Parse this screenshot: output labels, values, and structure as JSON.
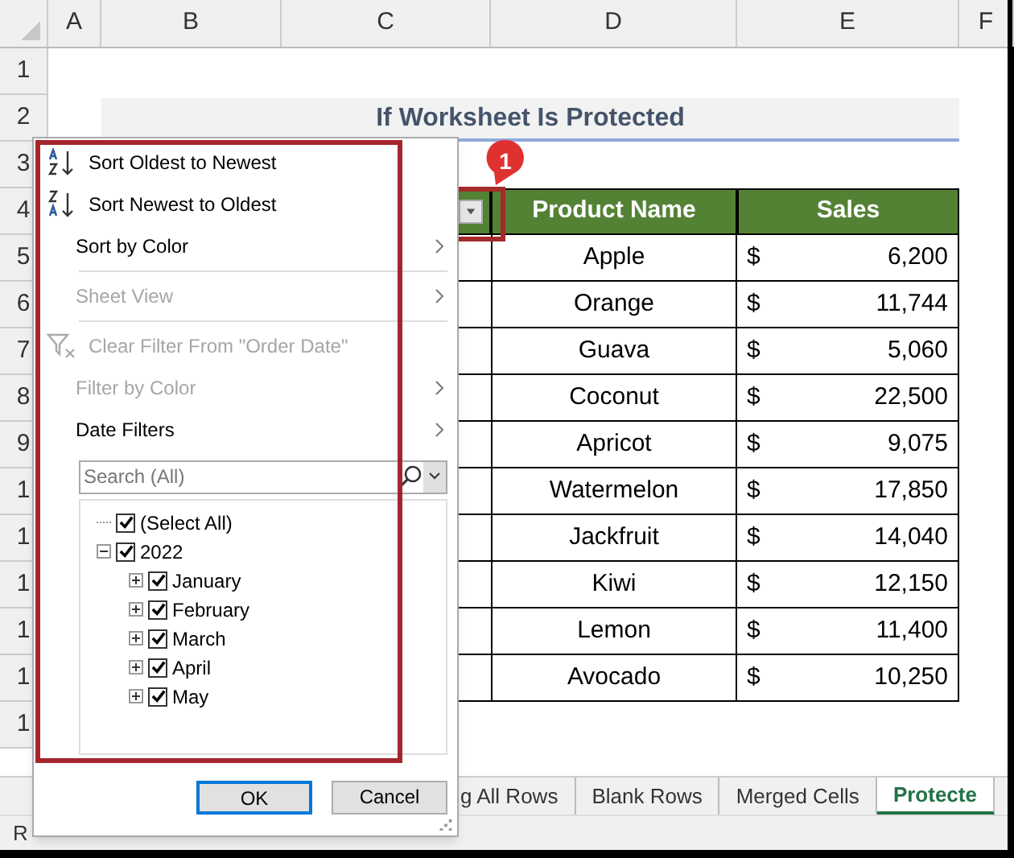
{
  "columns": [
    "A",
    "B",
    "C",
    "D",
    "E",
    "F"
  ],
  "row_numbers": [
    "1",
    "2",
    "3",
    "4",
    "5",
    "6",
    "7",
    "8",
    "9",
    "1",
    "1",
    "1",
    "1",
    "1",
    "1"
  ],
  "title": "If Worksheet Is Protected",
  "table": {
    "columns": [
      "Product Name",
      "Sales"
    ],
    "rows": [
      {
        "product": "Apple",
        "currency": "$",
        "sales": "6,200"
      },
      {
        "product": "Orange",
        "currency": "$",
        "sales": "11,744"
      },
      {
        "product": "Guava",
        "currency": "$",
        "sales": "5,060"
      },
      {
        "product": "Coconut",
        "currency": "$",
        "sales": "22,500"
      },
      {
        "product": "Apricot",
        "currency": "$",
        "sales": "9,075"
      },
      {
        "product": "Watermelon",
        "currency": "$",
        "sales": "17,850"
      },
      {
        "product": "Jackfruit",
        "currency": "$",
        "sales": "14,040"
      },
      {
        "product": "Kiwi",
        "currency": "$",
        "sales": "12,150"
      },
      {
        "product": "Lemon",
        "currency": "$",
        "sales": "11,400"
      },
      {
        "product": "Avocado",
        "currency": "$",
        "sales": "10,250"
      }
    ]
  },
  "callout": {
    "label": "1"
  },
  "filter_menu": {
    "items": [
      {
        "kind": "sort_asc",
        "label": "Sort Oldest to Newest",
        "disabled": false,
        "submenu": false
      },
      {
        "kind": "sort_desc",
        "label": "Sort Newest to Oldest",
        "disabled": false,
        "submenu": false
      },
      {
        "kind": "plain",
        "label": "Sort by Color",
        "disabled": false,
        "submenu": true
      },
      {
        "kind": "separator"
      },
      {
        "kind": "plain",
        "label": "Sheet View",
        "disabled": true,
        "submenu": true
      },
      {
        "kind": "separator"
      },
      {
        "kind": "clear_filter",
        "label": "Clear Filter From \"Order Date\"",
        "disabled": true,
        "submenu": false
      },
      {
        "kind": "plain",
        "label": "Filter by Color",
        "disabled": true,
        "submenu": true
      },
      {
        "kind": "plain",
        "label": "Date Filters",
        "disabled": false,
        "submenu": true
      }
    ],
    "search": {
      "placeholder": "Search (All)"
    },
    "tree": [
      {
        "label": "(Select All)",
        "checked": true
      },
      {
        "label": "2022",
        "checked": true,
        "expanded": true,
        "children": [
          {
            "label": "January",
            "checked": true,
            "expanded": false
          },
          {
            "label": "February",
            "checked": true,
            "expanded": false
          },
          {
            "label": "March",
            "checked": true,
            "expanded": false
          },
          {
            "label": "April",
            "checked": true,
            "expanded": false
          },
          {
            "label": "May",
            "checked": true,
            "expanded": false
          }
        ]
      }
    ],
    "buttons": [
      "OK",
      "Cancel"
    ]
  },
  "sheet_tabs": [
    {
      "label": "g All Rows",
      "selected": false
    },
    {
      "label": "Blank Rows",
      "selected": false
    },
    {
      "label": "Merged Cells",
      "selected": false
    },
    {
      "label": "Protecte",
      "selected": true
    }
  ],
  "status_bar": {
    "text": "R"
  }
}
